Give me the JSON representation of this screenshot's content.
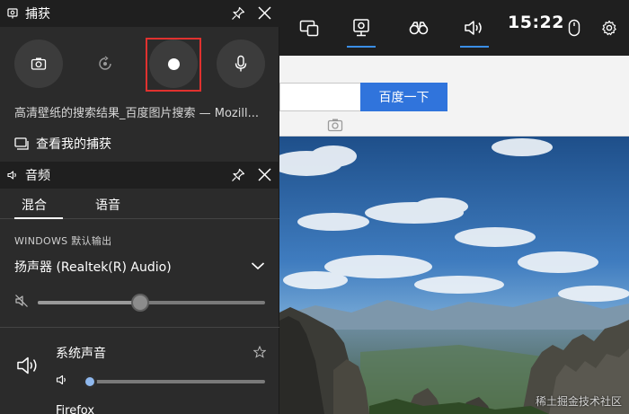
{
  "gamebar": {
    "time": "15:22",
    "items": [
      {
        "icon": "widget-menu-icon",
        "active": false
      },
      {
        "icon": "capture-icon",
        "active": true
      },
      {
        "icon": "binoculars-icon",
        "active": false
      },
      {
        "icon": "audio-icon",
        "active": true
      },
      {
        "icon": "mouse-icon",
        "active": false
      },
      {
        "icon": "gear-icon",
        "active": false
      }
    ]
  },
  "capture": {
    "title": "捕获",
    "buttons": [
      "screenshot-icon",
      "record-last-icon",
      "record-icon",
      "microphone-icon"
    ],
    "window_name": "高清壁纸的搜索结果_百度图片搜索 — Mozill...",
    "gallery_link": "查看我的捕获"
  },
  "audio": {
    "title": "音频",
    "tabs": [
      "混合",
      "语音"
    ],
    "active_tab": 0,
    "output_label": "WINDOWS 默认输出",
    "device": "扬声器 (Realtek(R) Audio)",
    "master_volume": 0.45,
    "apps": [
      {
        "name": "系统声音",
        "volume": 0.02
      },
      {
        "name": "Firefox"
      }
    ]
  },
  "browser": {
    "search_button": "百度一下"
  },
  "watermark": "稀土掘金技术社区",
  "colors": {
    "accent": "#3a8ee6",
    "record_highlight": "#e0312f",
    "baidu_blue": "#3074dc",
    "panel_bg": "#2b2b2b",
    "header_bg": "#1f1f1f"
  }
}
